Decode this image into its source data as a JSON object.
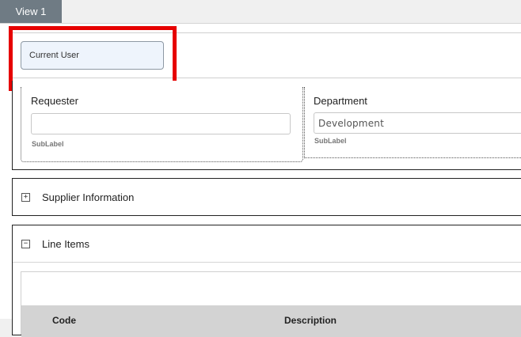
{
  "tabs": [
    {
      "label": "View 1"
    }
  ],
  "user_panel": {
    "button_label": "Current User"
  },
  "requester": {
    "label": "Requester",
    "value": "",
    "sublabel": "SubLabel"
  },
  "department": {
    "label": "Department",
    "value": "Development",
    "sublabel": "SubLabel"
  },
  "supplier_panel": {
    "title": "Supplier Information",
    "toggle": "+"
  },
  "line_items_panel": {
    "title": "Line Items",
    "toggle": "−",
    "columns": [
      "Code",
      "Description"
    ]
  },
  "colors": {
    "tab_bg": "#6f7b84",
    "highlight": "#e60000",
    "button_bg": "#eef4fc"
  }
}
